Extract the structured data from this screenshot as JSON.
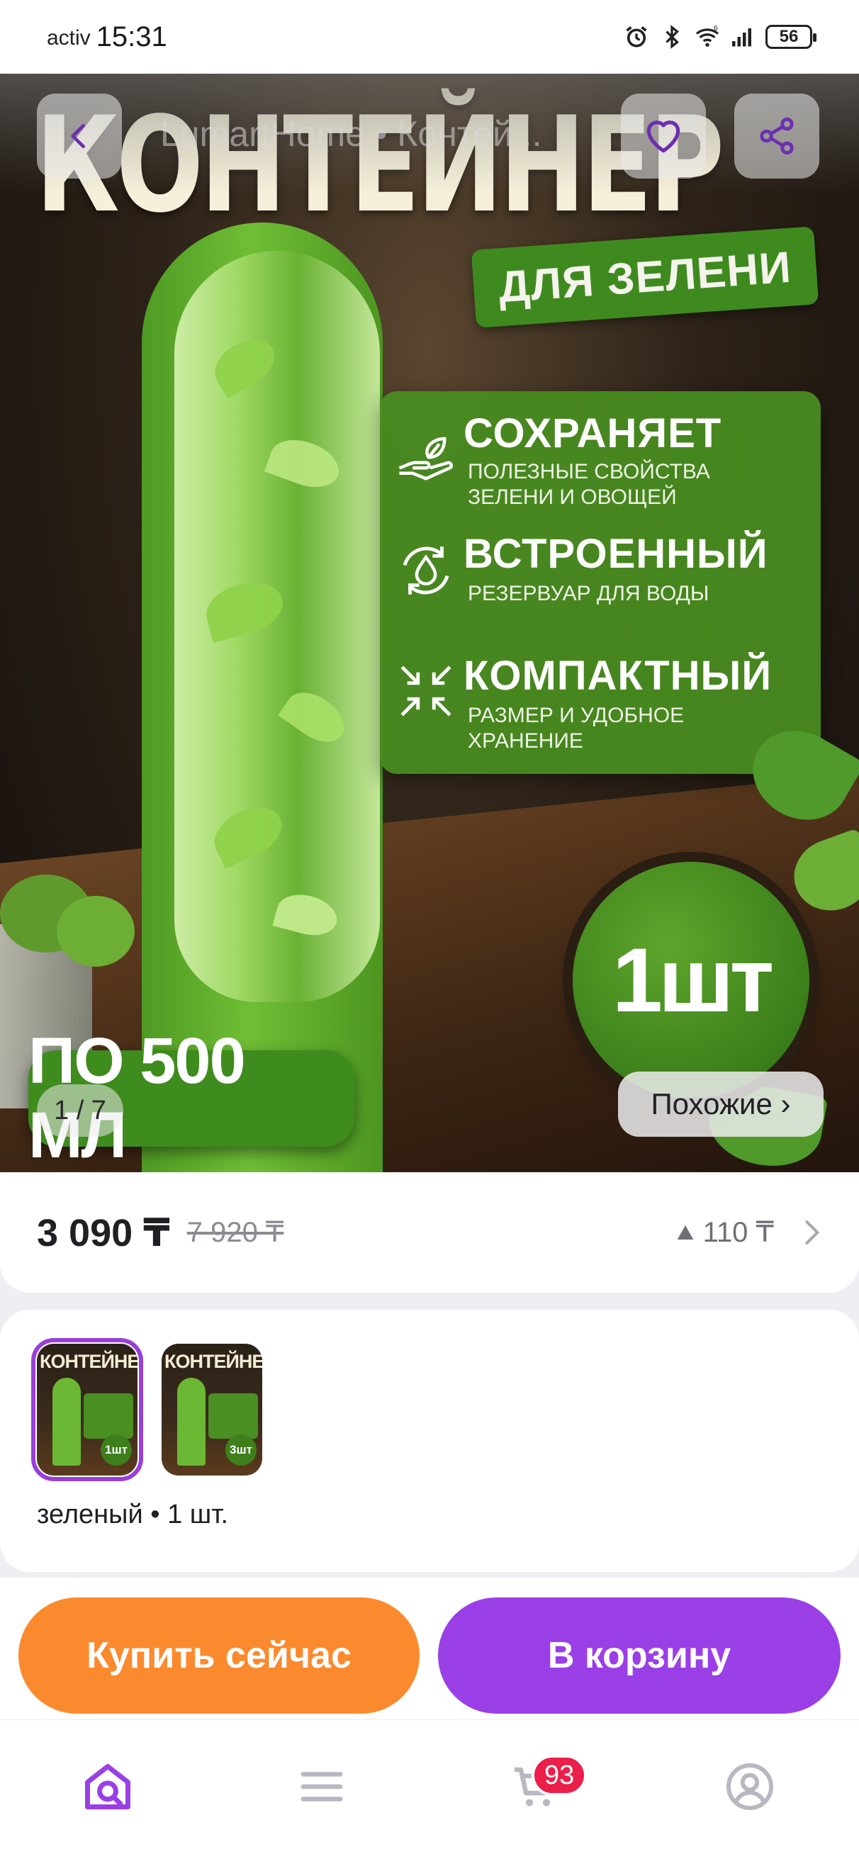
{
  "status_bar": {
    "carrier": "activ",
    "time": "15:31",
    "network_label": "6",
    "battery": "56"
  },
  "product": {
    "title": "LumartHome • Контей...",
    "image": {
      "headline": "КОНТЕЙНЕР",
      "subheadline": "ДЛЯ ЗЕЛЕНИ",
      "features": [
        {
          "icon": "hand-leaf-icon",
          "title": "СОХРАНЯЕТ",
          "text": "ПОЛЕЗНЫЕ СВОЙСТВА\nЗЕЛЕНИ И ОВОЩЕЙ"
        },
        {
          "icon": "water-cycle-icon",
          "title": "ВСТРОЕННЫЙ",
          "text": "РЕЗЕРВУАР ДЛЯ ВОДЫ"
        },
        {
          "icon": "compress-arrows-icon",
          "title": "КОМПАКТНЫЙ",
          "text": "РАЗМЕР И УДОБНОЕ\nХРАНЕНИЕ"
        }
      ],
      "quantity_badge": "1шт",
      "volume_badge": "ПО 500 МЛ"
    },
    "gallery_counter": "1 / 7",
    "similar_label": "Похожие ›",
    "price": "3 090 ₸",
    "old_price": "7 920 ₸",
    "price_change": "110 ₸",
    "variants": [
      {
        "title": "КОНТЕЙНЕР",
        "qty": "1шт",
        "selected": true
      },
      {
        "title": "КОНТЕЙНЕР",
        "qty": "3шт",
        "selected": false
      }
    ],
    "selected_variant_label": "зеленый • 1 шт."
  },
  "actions": {
    "buy_now": "Купить сейчас",
    "add_to_cart": "В корзину"
  },
  "bottom_nav": {
    "items": [
      {
        "icon": "home-search-icon",
        "active": true
      },
      {
        "icon": "catalog-menu-icon",
        "active": false
      },
      {
        "icon": "cart-icon",
        "active": false
      },
      {
        "icon": "profile-icon",
        "active": false
      }
    ],
    "cart_badge": "93"
  },
  "colors": {
    "accent_purple": "#9a3fe6",
    "accent_orange": "#fb8a2e",
    "badge_red": "#ea1f4a",
    "product_green": "#4e9a24"
  }
}
